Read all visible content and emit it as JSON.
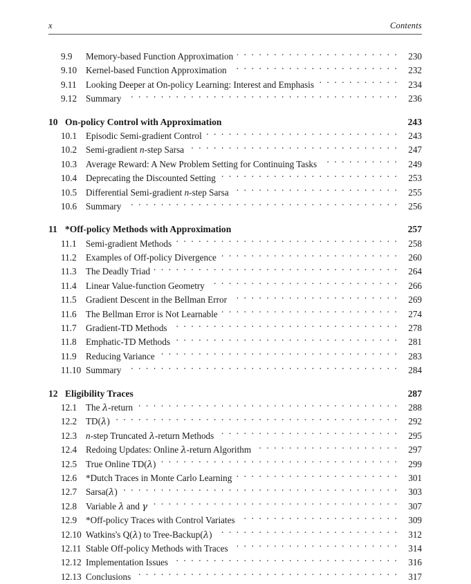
{
  "header": {
    "folio": "x",
    "running_title": "Contents"
  },
  "toc": {
    "entries": [
      {
        "level": "section",
        "num": "9.9",
        "title": "Memory-based Function Approximation",
        "page": "230"
      },
      {
        "level": "section",
        "num": "9.10",
        "title": "Kernel-based Function Approximation",
        "page": "232"
      },
      {
        "level": "section",
        "num": "9.11",
        "title": "Looking Deeper at On-policy Learning: Interest and Emphasis",
        "page": "234"
      },
      {
        "level": "section",
        "num": "9.12",
        "title": "Summary",
        "page": "236"
      },
      {
        "level": "chapter",
        "num": "10",
        "title": "On-policy Control with Approximation",
        "page": "243"
      },
      {
        "level": "section",
        "num": "10.1",
        "title": "Episodic Semi-gradient Control",
        "page": "243"
      },
      {
        "level": "section",
        "num": "10.2",
        "title": "Semi-gradient n-step Sarsa",
        "title_html": "Semi-gradient <span class=\"mi\">n</span>-step Sarsa",
        "page": "247"
      },
      {
        "level": "section",
        "num": "10.3",
        "title": "Average Reward: A New Problem Setting for Continuing Tasks",
        "page": "249"
      },
      {
        "level": "section",
        "num": "10.4",
        "title": "Deprecating the Discounted Setting",
        "page": "253"
      },
      {
        "level": "section",
        "num": "10.5",
        "title": "Differential Semi-gradient n-step Sarsa",
        "title_html": "Differential Semi-gradient <span class=\"mi\">n</span>-step Sarsa",
        "page": "255"
      },
      {
        "level": "section",
        "num": "10.6",
        "title": "Summary",
        "page": "256"
      },
      {
        "level": "chapter",
        "num": "11",
        "title": "*Off-policy Methods with Approximation",
        "page": "257"
      },
      {
        "level": "section",
        "num": "11.1",
        "title": "Semi-gradient Methods",
        "page": "258"
      },
      {
        "level": "section",
        "num": "11.2",
        "title": "Examples of Off-policy Divergence",
        "page": "260"
      },
      {
        "level": "section",
        "num": "11.3",
        "title": "The Deadly Triad",
        "page": "264"
      },
      {
        "level": "section",
        "num": "11.4",
        "title": "Linear Value-function Geometry",
        "page": "266"
      },
      {
        "level": "section",
        "num": "11.5",
        "title": "Gradient Descent in the Bellman Error",
        "page": "269"
      },
      {
        "level": "section",
        "num": "11.6",
        "title": "The Bellman Error is Not Learnable",
        "page": "274"
      },
      {
        "level": "section",
        "num": "11.7",
        "title": "Gradient-TD Methods",
        "page": "278"
      },
      {
        "level": "section",
        "num": "11.8",
        "title": "Emphatic-TD Methods",
        "page": "281"
      },
      {
        "level": "section",
        "num": "11.9",
        "title": "Reducing Variance",
        "page": "283"
      },
      {
        "level": "section",
        "num": "11.10",
        "title": "Summary",
        "page": "284"
      },
      {
        "level": "chapter",
        "num": "12",
        "title": "Eligibility Traces",
        "page": "287"
      },
      {
        "level": "section",
        "num": "12.1",
        "title": "The λ-return",
        "title_html": "The <span class=\"greek\">λ</span>-return",
        "page": "288"
      },
      {
        "level": "section",
        "num": "12.2",
        "title": "TD(λ)",
        "title_html": "TD(<span class=\"greek\">λ</span>)",
        "page": "292"
      },
      {
        "level": "section",
        "num": "12.3",
        "title": "n-step Truncated λ-return Methods",
        "title_html": "<span class=\"mi\">n</span>-step Truncated <span class=\"greek\">λ</span>-return Methods",
        "page": "295"
      },
      {
        "level": "section",
        "num": "12.4",
        "title": "Redoing Updates: Online λ-return Algorithm",
        "title_html": "Redoing Updates: Online <span class=\"greek\">λ</span>-return Algorithm",
        "page": "297"
      },
      {
        "level": "section",
        "num": "12.5",
        "title": "True Online TD(λ)",
        "title_html": "True Online TD(<span class=\"greek\">λ</span>)",
        "page": "299"
      },
      {
        "level": "section",
        "num": "12.6",
        "title": "*Dutch Traces in Monte Carlo Learning",
        "page": "301"
      },
      {
        "level": "section",
        "num": "12.7",
        "title": "Sarsa(λ)",
        "title_html": "Sarsa(<span class=\"greek\">λ</span>)",
        "page": "303"
      },
      {
        "level": "section",
        "num": "12.8",
        "title": "Variable λ and γ",
        "title_html": "Variable <span class=\"greek\">λ</span> and <span class=\"greek\">γ</span>",
        "page": "307"
      },
      {
        "level": "section",
        "num": "12.9",
        "title": "*Off-policy Traces with Control Variates",
        "page": "309"
      },
      {
        "level": "section",
        "num": "12.10",
        "title": "Watkins's Q(λ) to Tree-Backup(λ)",
        "title_html": "Watkins's Q(<span class=\"greek\">λ</span>) to Tree-Backup(<span class=\"greek\">λ</span>)",
        "page": "312"
      },
      {
        "level": "section",
        "num": "12.11",
        "title": "Stable Off-policy Methods with Traces",
        "page": "314"
      },
      {
        "level": "section",
        "num": "12.12",
        "title": "Implementation Issues",
        "page": "316"
      },
      {
        "level": "section",
        "num": "12.13",
        "title": "Conclusions",
        "page": "317"
      }
    ]
  }
}
